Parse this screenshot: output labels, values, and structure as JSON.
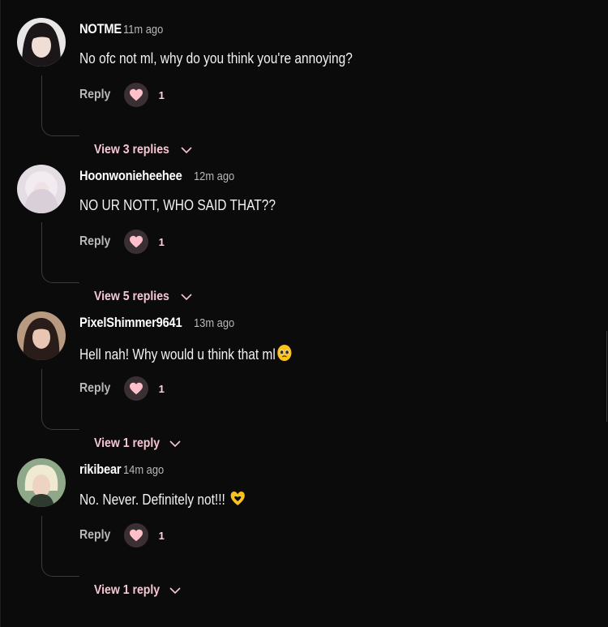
{
  "labels": {
    "reply": "Reply"
  },
  "colors": {
    "background": "#0b0b0b",
    "accent_pink": "#f6c7d3",
    "heart": "#ffc0cb"
  },
  "comments": [
    {
      "username": "NOTME",
      "time": "11m ago",
      "text": "No ofc not ml, why do you think you're annoying?",
      "emoji": "",
      "likes": "1",
      "view_replies": "View 3 replies"
    },
    {
      "username": "Hoonwonieheehee",
      "time": "12m ago",
      "text": "NO UR NOTT, WHO SAID THAT??",
      "emoji": "",
      "likes": "1",
      "view_replies": "View 5 replies"
    },
    {
      "username": "PixelShimmer9641",
      "time": "13m ago",
      "text": "Hell nah! Why would u think that ml",
      "emoji": "pleading-face-emoji",
      "likes": "1",
      "view_replies": "View 1 reply"
    },
    {
      "username": "rikibear",
      "time": "14m ago",
      "text": "No. Never. Definitely not!!!",
      "emoji": "heart-hands-emoji",
      "likes": "1",
      "view_replies": "View 1 reply"
    }
  ]
}
